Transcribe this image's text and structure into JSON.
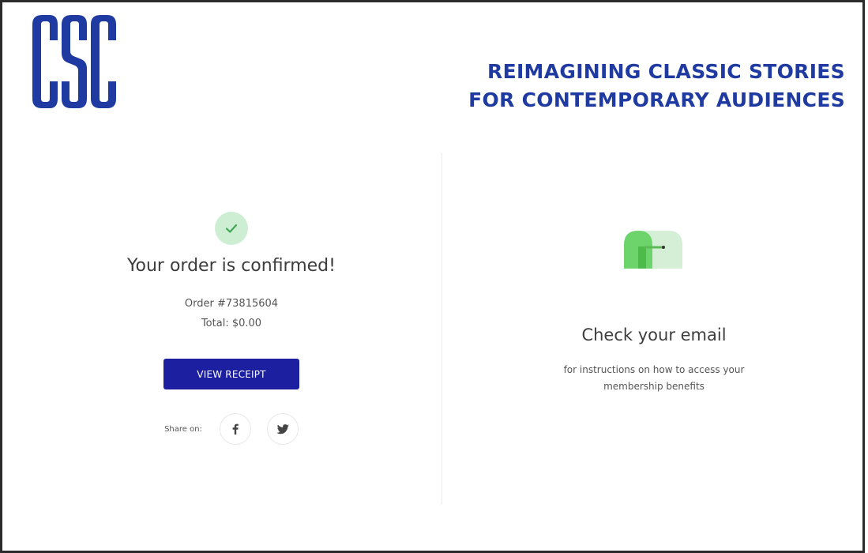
{
  "brand": {
    "logo_text": "CSC",
    "tagline_line1": "REIMAGINING CLASSIC STORIES",
    "tagline_line2": "FOR CONTEMPORARY AUDIENCES",
    "color": "#1f3aa0"
  },
  "order": {
    "status_title": "Your order is confirmed!",
    "order_number": "Order #73815604",
    "total": "Total: $0.00",
    "receipt_button_label": "VIEW RECEIPT",
    "button_color": "#1b1fa0",
    "share_label": "Share on:",
    "share_targets": [
      "facebook",
      "twitter"
    ],
    "check_icon": "check-icon"
  },
  "email_notice": {
    "title": "Check your email",
    "subtitle_line1": "for instructions on how to access your",
    "subtitle_line2": "membership benefits",
    "icon": "mailbox-icon"
  }
}
